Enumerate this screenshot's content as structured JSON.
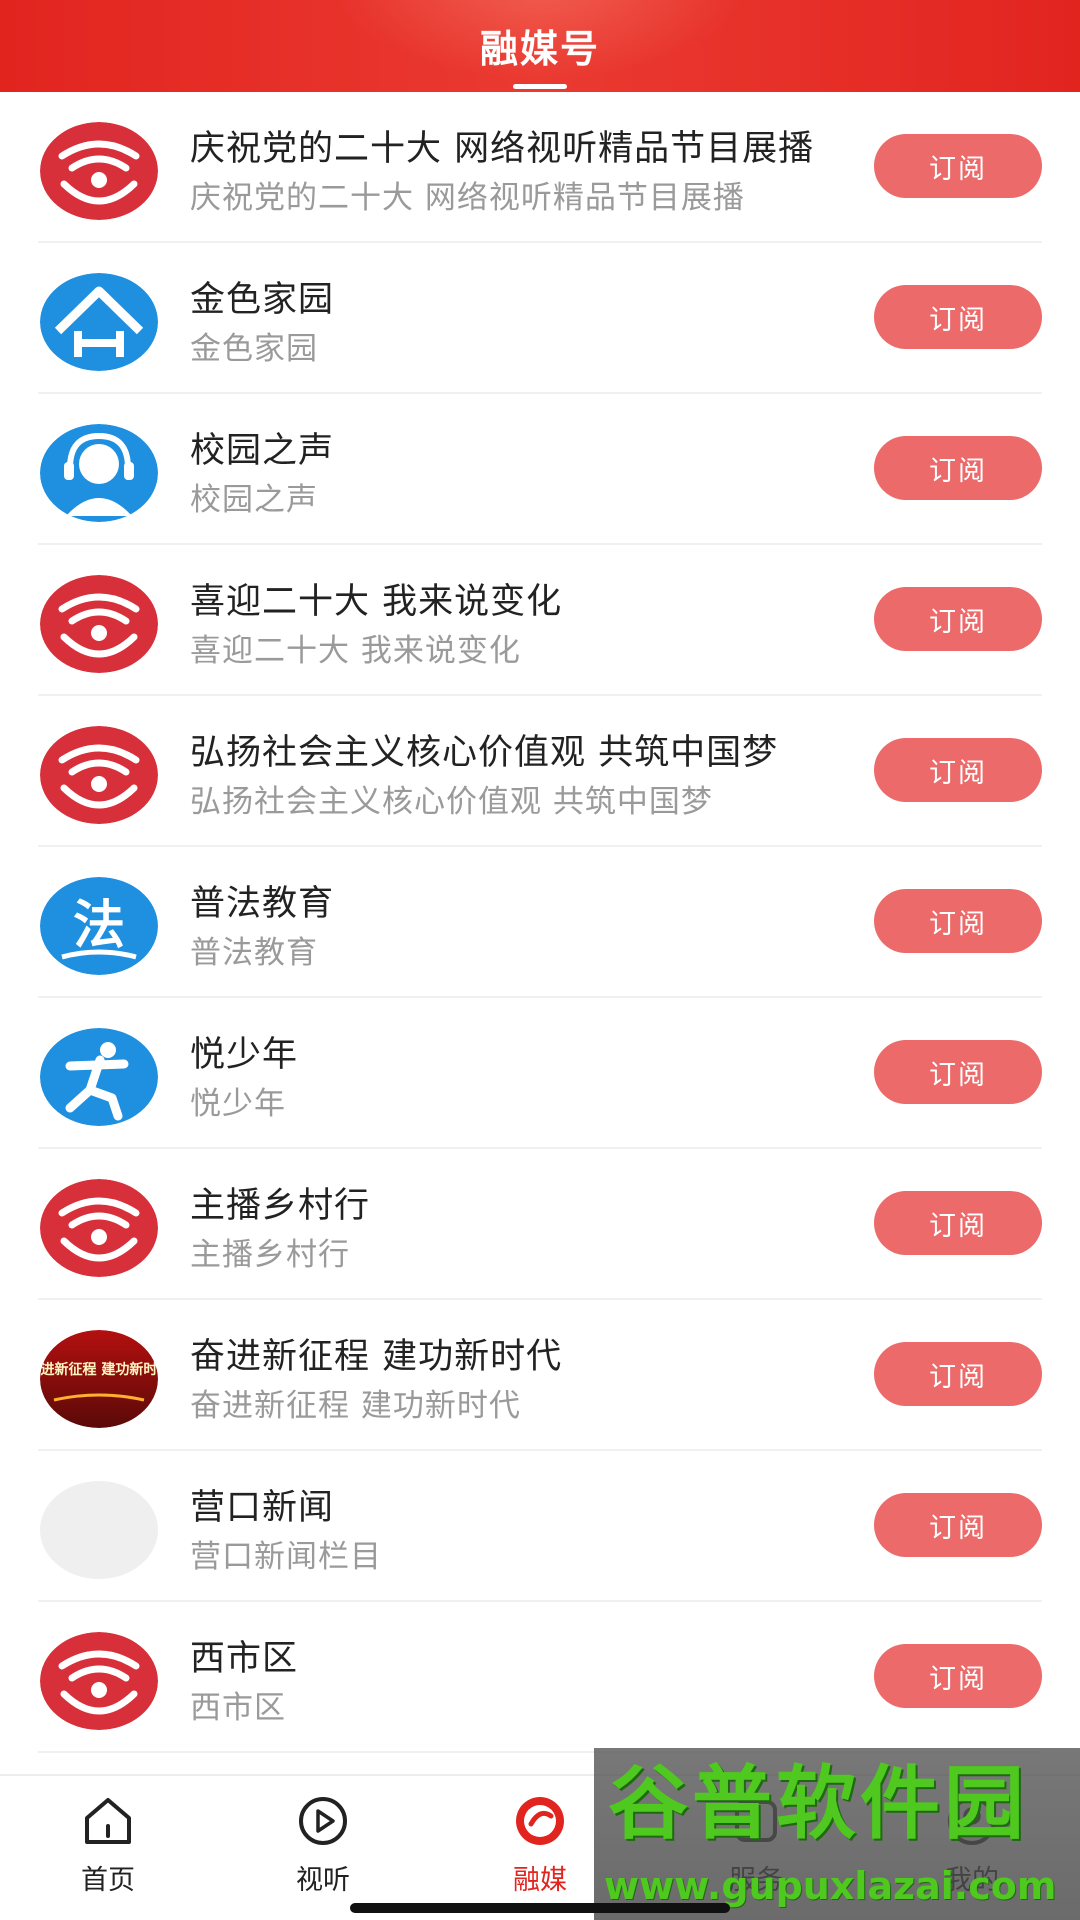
{
  "header": {
    "title": "融媒号"
  },
  "subscribe_label": "订阅",
  "accounts": [
    {
      "avatar": "radio-logo-icon",
      "title": "庆祝党的二十大 网络视听精品节目展播",
      "subtitle": "庆祝党的二十大 网络视听精品节目展播"
    },
    {
      "avatar": "house-logo-icon",
      "title": "金色家园",
      "subtitle": "金色家园"
    },
    {
      "avatar": "headset-person-icon",
      "title": "校园之声",
      "subtitle": "校园之声"
    },
    {
      "avatar": "radio-logo-icon",
      "title": "喜迎二十大 我来说变化",
      "subtitle": "喜迎二十大 我来说变化"
    },
    {
      "avatar": "radio-logo-icon",
      "title": "弘扬社会主义核心价值观 共筑中国梦",
      "subtitle": "弘扬社会主义核心价值观 共筑中国梦"
    },
    {
      "avatar": "law-logo-icon",
      "title": "普法教育",
      "subtitle": "普法教育"
    },
    {
      "avatar": "running-figure-icon",
      "title": "悦少年",
      "subtitle": "悦少年"
    },
    {
      "avatar": "radio-logo-icon",
      "title": "主播乡村行",
      "subtitle": "主播乡村行"
    },
    {
      "avatar": "banner-image",
      "avatar_text": "奋进新征程 建功新时代",
      "title": "奋进新征程 建功新时代",
      "subtitle": "奋进新征程 建功新时代"
    },
    {
      "avatar": "placeholder-avatar",
      "title": "营口新闻",
      "subtitle": "营口新闻栏目"
    },
    {
      "avatar": "radio-logo-icon",
      "title": "西市区",
      "subtitle": "西市区"
    }
  ],
  "tabbar": {
    "tabs": [
      {
        "label": "首页",
        "icon": "home-icon",
        "active": false
      },
      {
        "label": "视听",
        "icon": "play-icon",
        "active": false
      },
      {
        "label": "融媒",
        "icon": "media-icon",
        "active": true
      },
      {
        "label": "服务",
        "icon": "service-icon",
        "active": false
      },
      {
        "label": "我的",
        "icon": "profile-icon",
        "active": false
      }
    ]
  },
  "watermark": {
    "brand": "谷普软件园",
    "url": "www.gupuxlazai.com"
  },
  "colors": {
    "header_red": "#e2241f",
    "button_pink": "#ec6a6a",
    "active_tab": "#e2241f",
    "logo_blue": "#1f8fe0",
    "logo_red": "#d8303a"
  }
}
